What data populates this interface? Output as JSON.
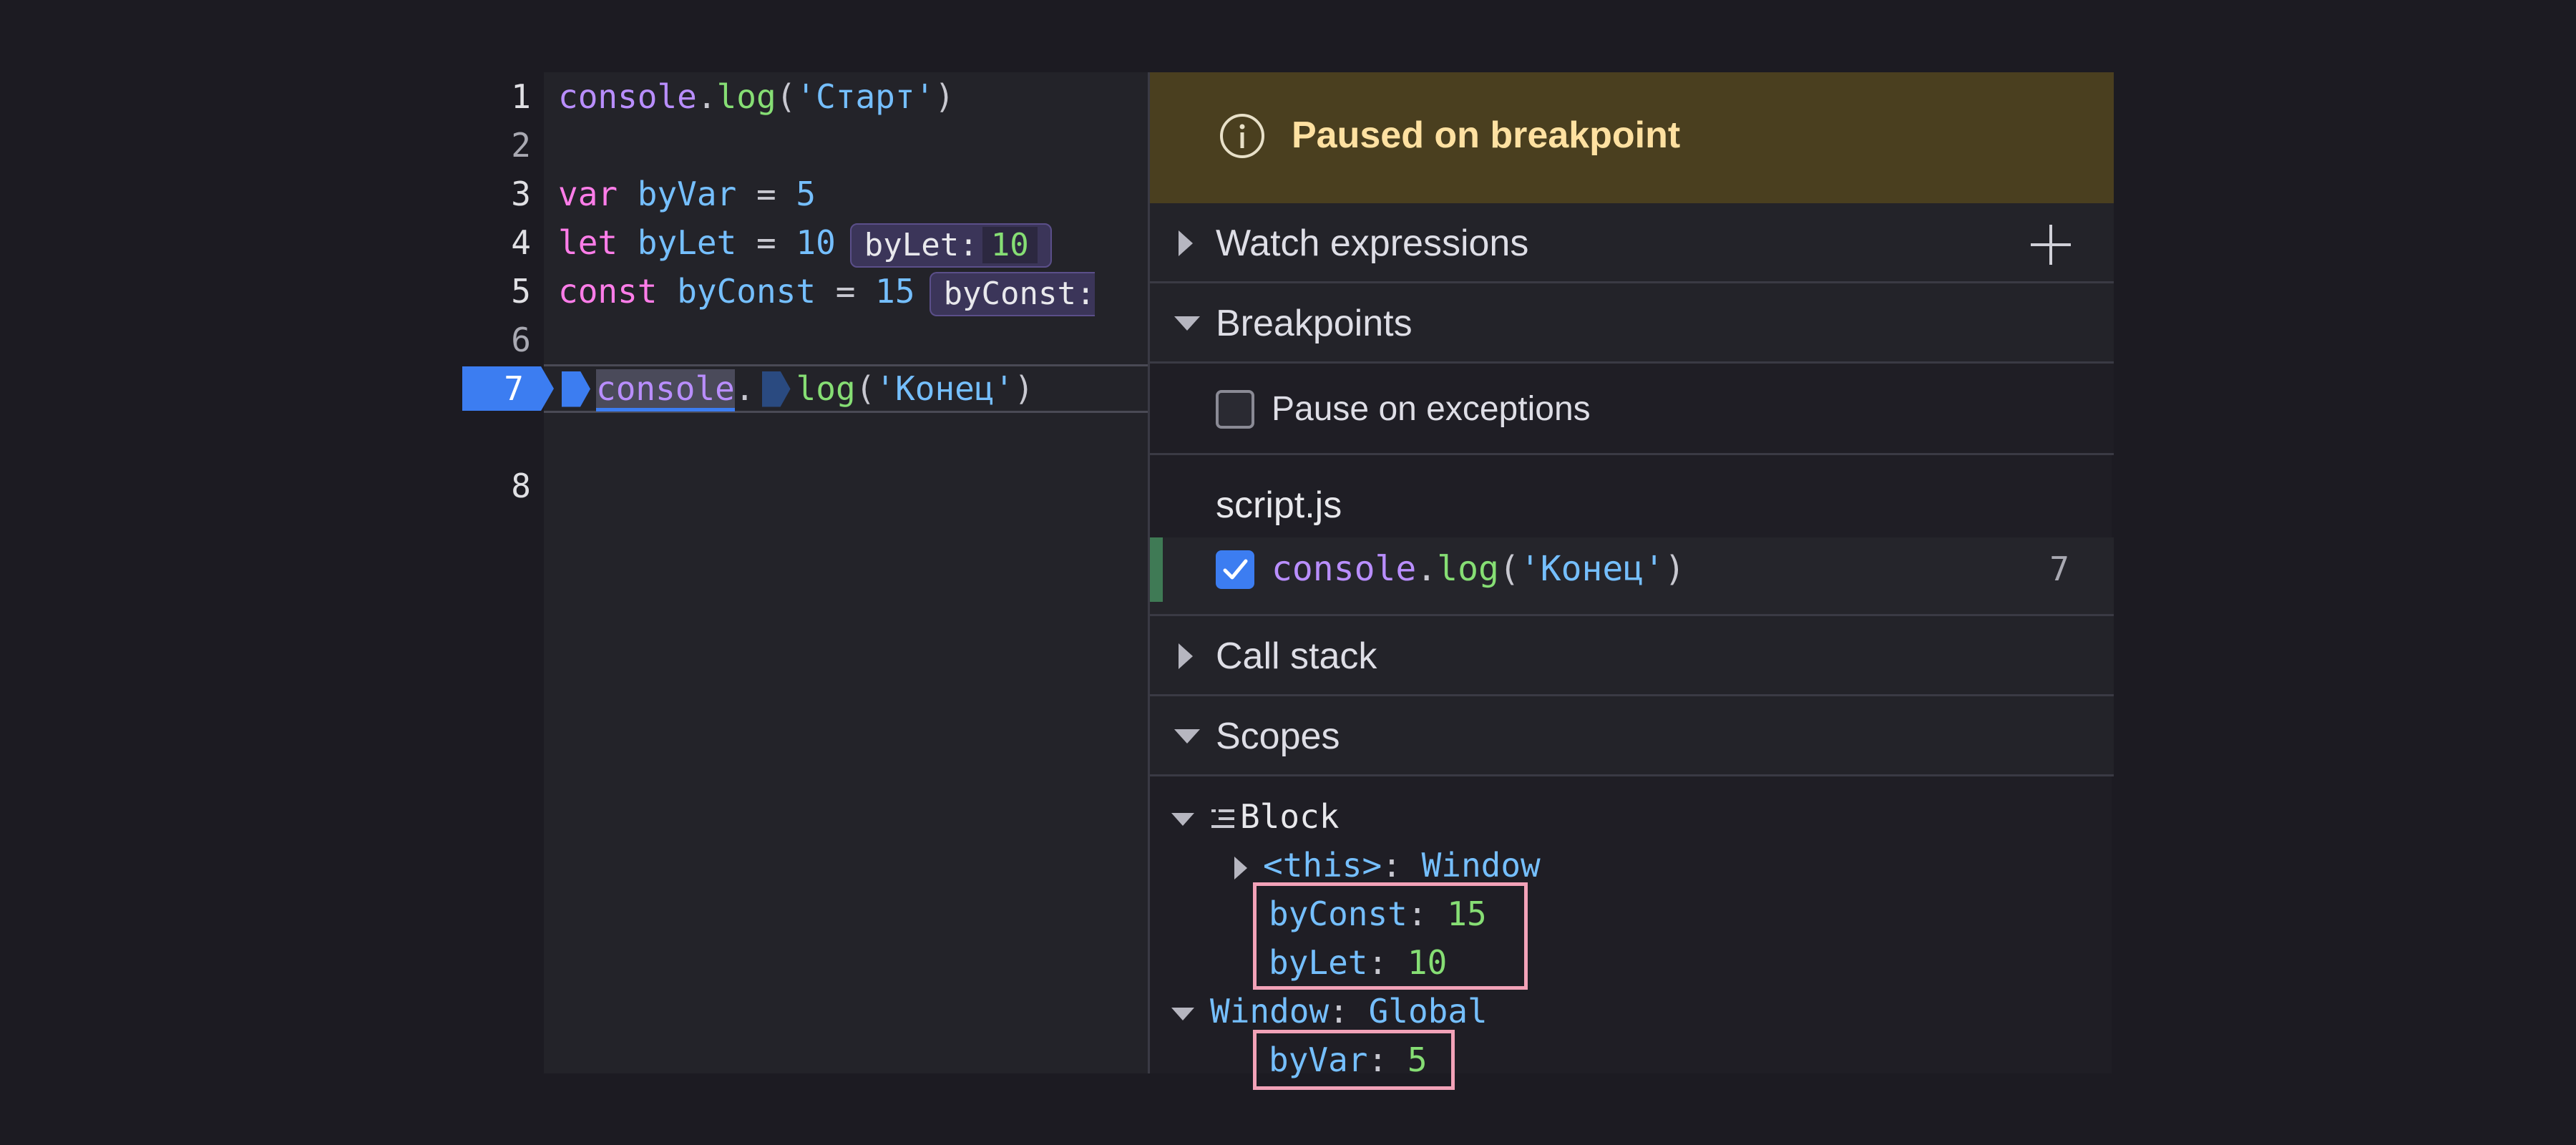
{
  "editor": {
    "line_numbers": [
      "1",
      "2",
      "3",
      "4",
      "5",
      "6",
      "7",
      "8"
    ],
    "lines": {
      "l1": {
        "obj": "console",
        "dot": ".",
        "fn": "log",
        "open": "(",
        "str": "'Старт'",
        "close": ")"
      },
      "l3": {
        "kw": "var",
        "name": "byVar",
        "eq": "=",
        "val": "5"
      },
      "l4": {
        "kw": "let",
        "name": "byLet",
        "eq": "=",
        "val": "10",
        "preview_label": "byLet:",
        "preview_value": "10"
      },
      "l5": {
        "kw": "const",
        "name": "byConst",
        "eq": "=",
        "val": "15",
        "preview_label": "byConst:"
      },
      "l7": {
        "obj": "console",
        "dot": ".",
        "fn": "log",
        "open": "(",
        "str": "'Конец'",
        "close": ")"
      }
    },
    "breakpoint_line": "7"
  },
  "sidebar": {
    "pause_message": "Paused on breakpoint",
    "sections": {
      "watch": "Watch expressions",
      "breakpoints": "Breakpoints",
      "call_stack": "Call stack",
      "scopes": "Scopes"
    },
    "pause_on_exceptions": {
      "label": "Pause on exceptions",
      "checked": false
    },
    "breakpoint_file": "script.js",
    "breakpoint_item": {
      "obj": "console",
      "dot": ".",
      "fn": "log",
      "open": "(",
      "str": "'Конец'",
      "close": ")",
      "line": "7",
      "checked": true
    },
    "scopes": {
      "block_label": "Block",
      "this_label": "<this>",
      "this_value": "Window",
      "byConst": {
        "name": "byConst",
        "value": "15"
      },
      "byLet": {
        "name": "byLet",
        "value": "10"
      },
      "window_label": "Window",
      "window_value": "Global",
      "byVar": {
        "name": "byVar",
        "value": "5"
      }
    }
  },
  "colors": {
    "keyword": "#ff7de9",
    "identifier": "#75bfff",
    "function": "#86de74",
    "number_value": "#86de74",
    "breakpoint": "#3c7df1",
    "pause_banner": "#4a3f1f",
    "highlight_box": "#f2a2b8"
  },
  "icons": {
    "info": "info-circle-icon",
    "add": "plus-icon",
    "expand": "triangle-right-icon",
    "collapse": "triangle-down-icon",
    "scope_block": "block-scope-icon",
    "check": "checkmark-icon"
  }
}
